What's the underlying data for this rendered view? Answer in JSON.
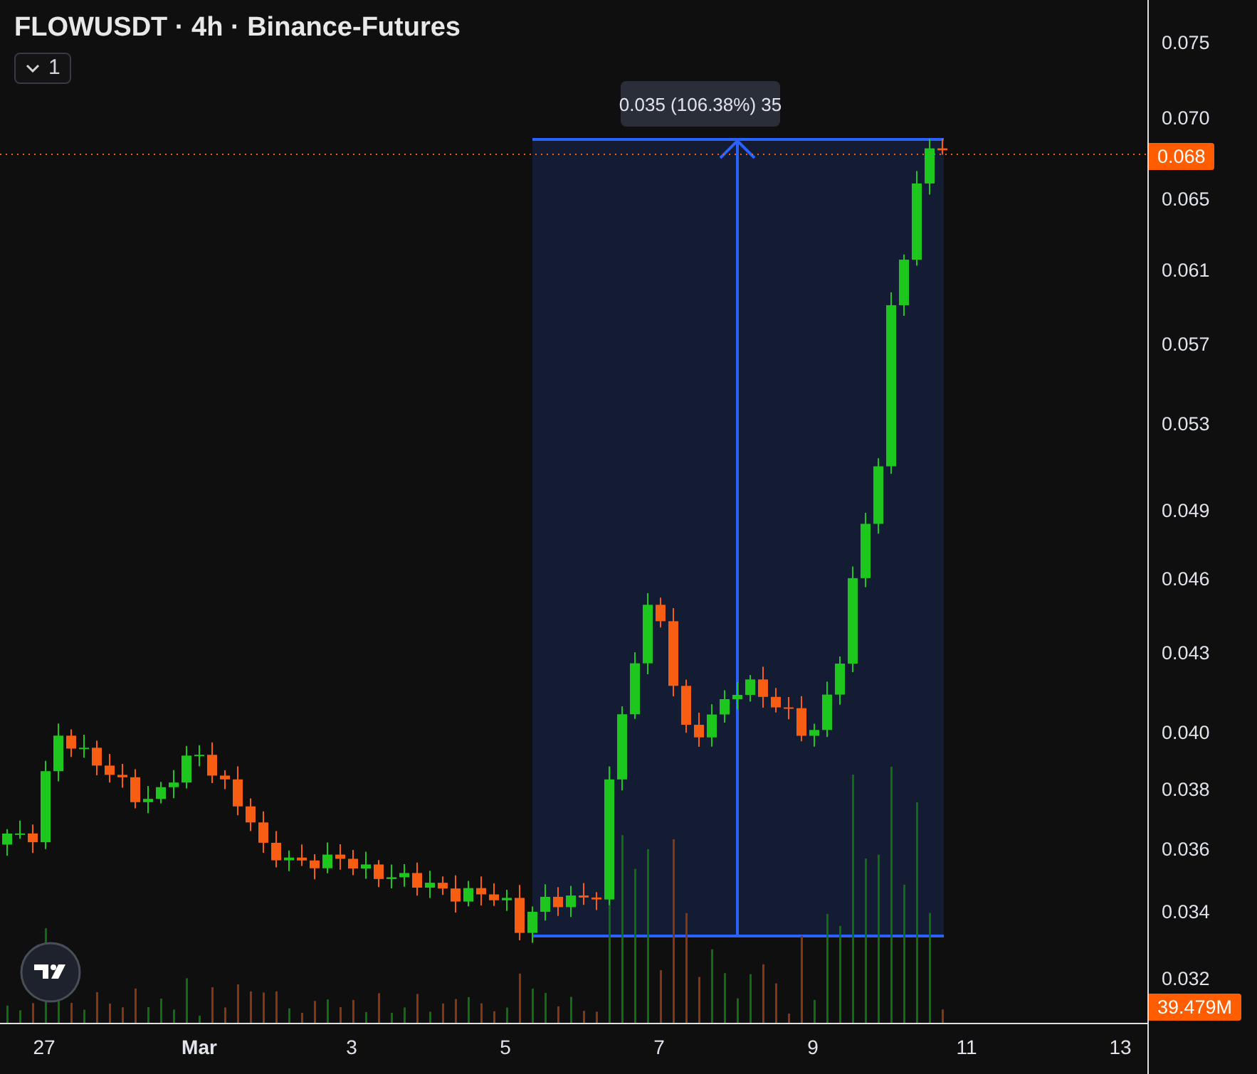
{
  "legend": {
    "title": "FLOWUSDT · 4h · Binance-Futures",
    "indicator_count": "1"
  },
  "measure": {
    "label": "0.035 (106.38%) 35"
  },
  "price_axis": {
    "ticks": [
      "0.075",
      "0.070",
      "0.065",
      "0.061",
      "0.057",
      "0.053",
      "0.049",
      "0.046",
      "0.043",
      "0.040",
      "0.038",
      "0.036",
      "0.034",
      "0.032"
    ],
    "last_price": "0.068",
    "volume": "39.479M"
  },
  "time_axis": {
    "labels": [
      "27",
      "Mar",
      "3",
      "5",
      "7",
      "9",
      "11",
      "13"
    ]
  }
}
